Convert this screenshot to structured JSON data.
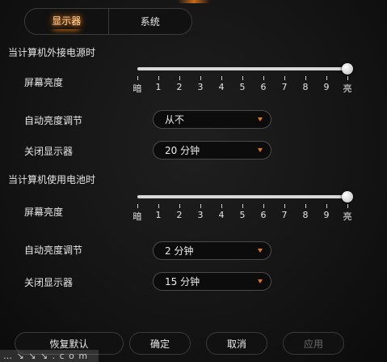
{
  "tabs": [
    {
      "label": "显示器",
      "active": true
    },
    {
      "label": "系统",
      "active": false
    }
  ],
  "ac_section": {
    "title": "当计算机外接电源时",
    "brightness_label": "屏幕亮度",
    "brightness_level": 10,
    "auto_brightness_label": "自动亮度调节",
    "auto_brightness_value": "从不",
    "display_off_label": "关闭显示器",
    "display_off_value": "20 分钟"
  },
  "battery_section": {
    "title": "当计算机使用电池时",
    "brightness_label": "屏幕亮度",
    "brightness_level": 10,
    "auto_brightness_label": "自动亮度调节",
    "auto_brightness_value": "2 分钟",
    "display_off_label": "关闭显示器",
    "display_off_value": "15 分钟"
  },
  "slider_ticks": [
    "暗",
    "1",
    "2",
    "3",
    "4",
    "5",
    "6",
    "7",
    "8",
    "9",
    "亮"
  ],
  "buttons": {
    "restore": "恢复默认",
    "ok": "确定",
    "cancel": "取消",
    "apply": "应用"
  },
  "watermark": "… ↘ ↘ ↘ . c o m",
  "colors": {
    "accent": "#e07418",
    "background": "#141414",
    "text": "#e6e6e6"
  }
}
